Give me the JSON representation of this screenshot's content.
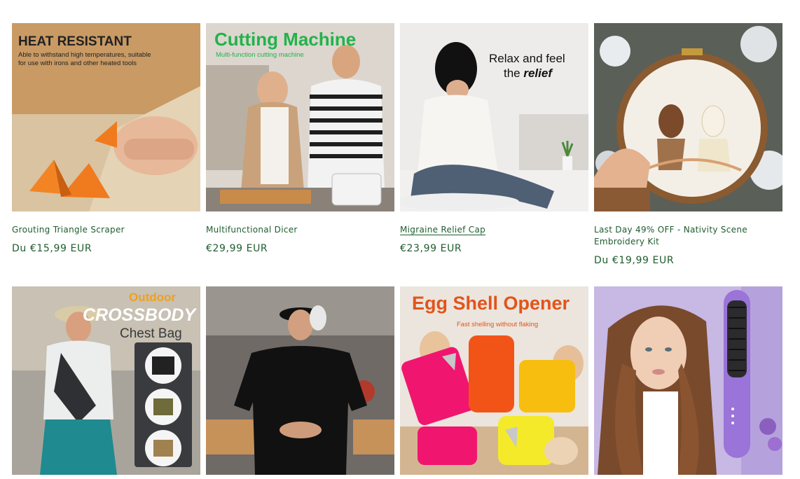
{
  "products": [
    {
      "name": "Grouting Triangle Scraper",
      "price": "Du €15,99 EUR",
      "image_headline": "HEAT RESISTANT",
      "image_subline1": "Able to withstand high temperatures, suitable",
      "image_subline2": "for use with irons and other heated tools"
    },
    {
      "name": "Multifunctional Dicer",
      "price": "€29,99 EUR",
      "image_headline": "Cutting Machine",
      "image_subline1": "Multi-function cutting machine"
    },
    {
      "name": "Migraine Relief Cap",
      "price": "€23,99 EUR",
      "image_headline1": "Relax and feel",
      "image_headline2": "the ",
      "image_headline2_em": "relief"
    },
    {
      "name": "Last Day 49% OFF - Nativity Scene Embroidery Kit",
      "price": "Du €19,99 EUR"
    },
    {
      "name": "",
      "price": "",
      "image_headline1": "Outdoor",
      "image_headline2": "CROSSBODY",
      "image_headline3": "Chest Bag"
    },
    {
      "name": "",
      "price": ""
    },
    {
      "name": "",
      "price": "",
      "image_headline": "Egg Shell Opener",
      "image_subline1": "Fast shelling without flaking"
    },
    {
      "name": "",
      "price": ""
    }
  ],
  "colors": {
    "text": "#1f5c2e",
    "cutting_green": "#22b34a",
    "egg_orange": "#e2541b",
    "outdoor_orange": "#f0a020"
  }
}
